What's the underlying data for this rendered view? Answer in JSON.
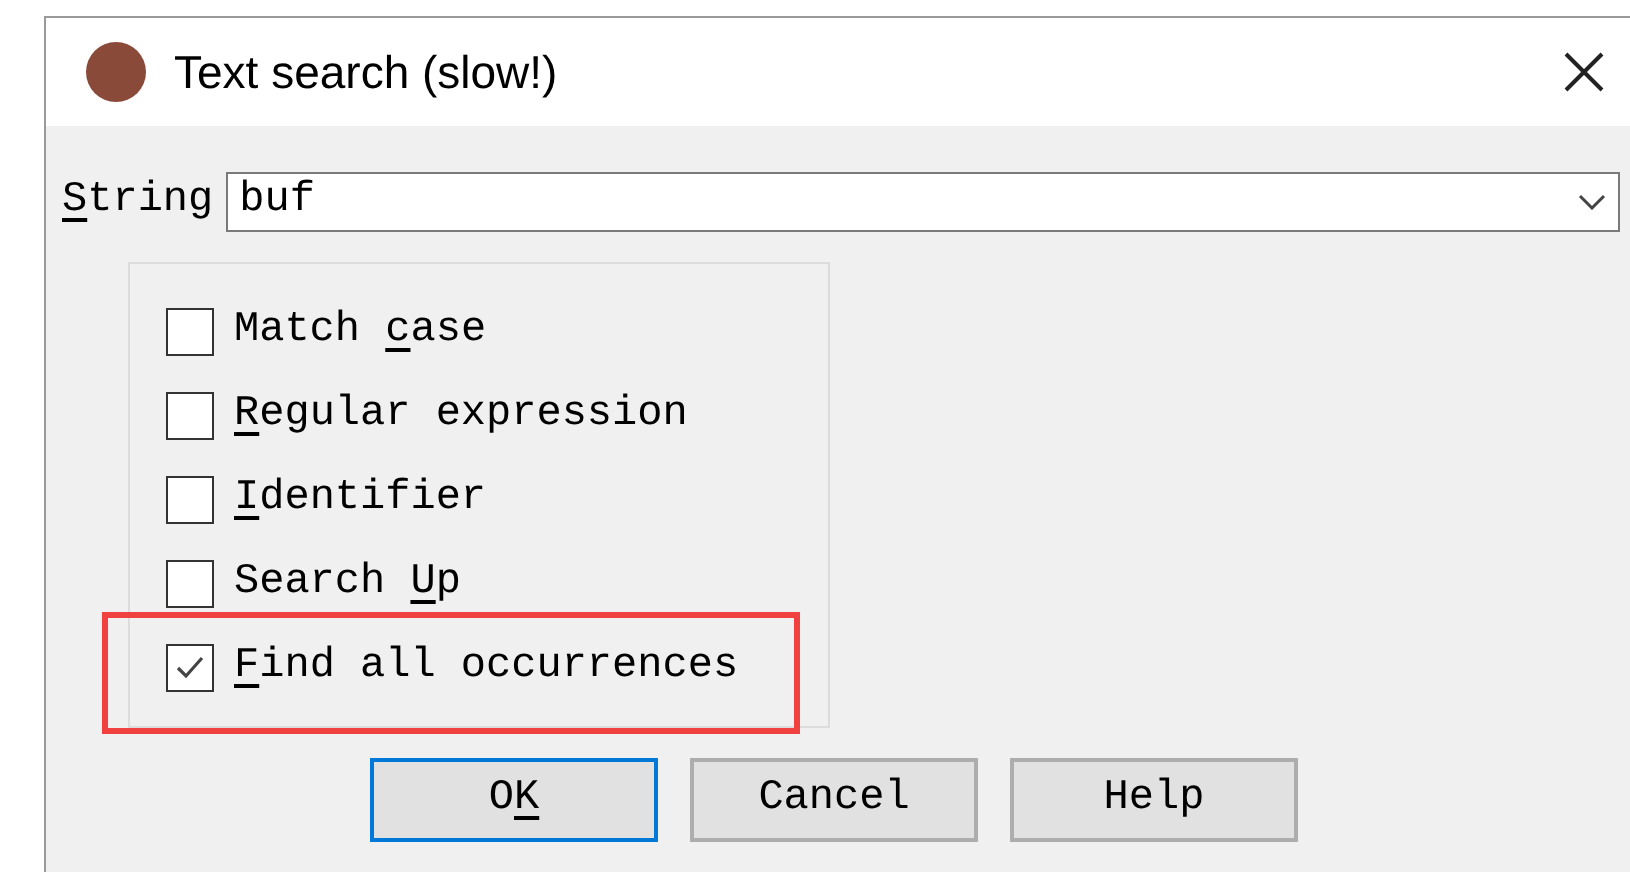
{
  "window": {
    "title": "Text search (slow!)"
  },
  "string_field": {
    "label": {
      "key": "S",
      "post": "tring"
    },
    "value": "buf"
  },
  "options": [
    {
      "label": {
        "pre": "Match ",
        "key": "c",
        "post": "ase"
      },
      "checked": false,
      "highlighted": false
    },
    {
      "label": {
        "key": "R",
        "post": "egular expression"
      },
      "checked": false,
      "highlighted": false
    },
    {
      "label": {
        "key": "I",
        "post": "dentifier"
      },
      "checked": false,
      "highlighted": false
    },
    {
      "label": {
        "pre": "Search ",
        "key": "U",
        "post": "p"
      },
      "checked": false,
      "highlighted": false
    },
    {
      "label": {
        "key": "F",
        "post": "ind all occurrences"
      },
      "checked": true,
      "highlighted": true
    }
  ],
  "buttons": [
    {
      "label": {
        "pre": "O",
        "key": "K"
      },
      "default": true
    },
    {
      "label": {
        "pre": "Cancel"
      },
      "default": false
    },
    {
      "label": {
        "pre": "Help"
      },
      "default": false
    }
  ]
}
